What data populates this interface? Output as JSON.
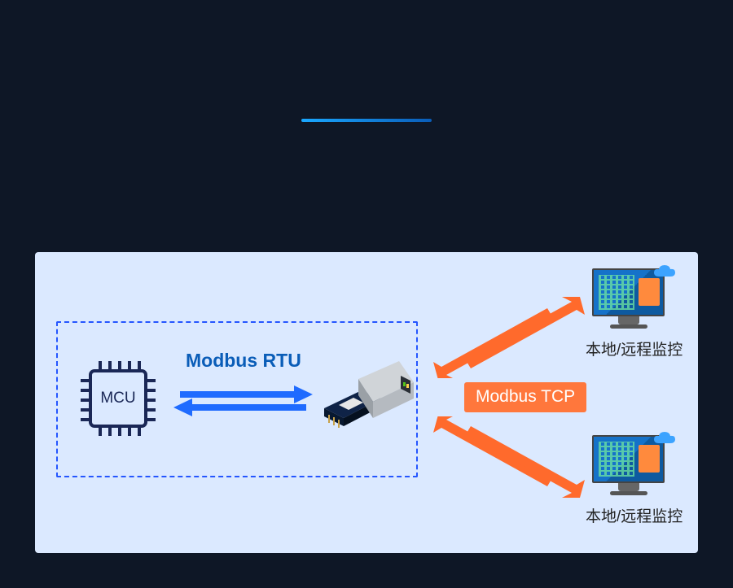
{
  "diagram": {
    "mcu_label": "MCU",
    "rtu_protocol_label": "Modbus RTU",
    "tcp_protocol_label": "Modbus TCP",
    "monitor_label_top": "本地/远程监控",
    "monitor_label_bottom": "本地/远程监控"
  },
  "colors": {
    "page_bg": "#0e1726",
    "panel_bg": "#dbe9ff",
    "dashed_border": "#2556ff",
    "rtu_text": "#0a5db8",
    "tcp_badge_bg": "#ff773c",
    "orange_arrow": "#ff6a2c",
    "blue_arrow": "#1f6bff",
    "divider_gradient_from": "#1aa8ff",
    "divider_gradient_to": "#0a5db8"
  }
}
